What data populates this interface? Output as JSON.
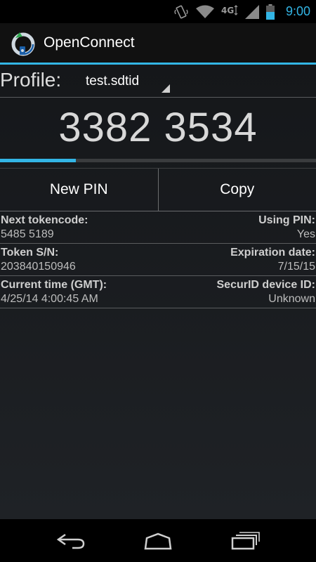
{
  "status_bar": {
    "time": "9:00",
    "network": "4G",
    "icons": [
      "vibrate-icon",
      "wifi-icon",
      "network-4g-icon",
      "signal-icon",
      "battery-icon"
    ]
  },
  "action_bar": {
    "title": "OpenConnect",
    "icon": "openconnect-logo-icon"
  },
  "profile": {
    "label": "Profile:",
    "selected": "test.sdtid"
  },
  "token": {
    "code": "3382 3534",
    "progress_percent": 24
  },
  "buttons": {
    "new_pin": "New PIN",
    "copy": "Copy"
  },
  "info": {
    "next_tokencode_label": "Next tokencode:",
    "next_tokencode_value": "5485 5189",
    "using_pin_label": "Using PIN:",
    "using_pin_value": "Yes",
    "token_sn_label": "Token S/N:",
    "token_sn_value": "203840150946",
    "expiration_label": "Expiration date:",
    "expiration_value": "7/15/15",
    "current_time_label": "Current time (GMT):",
    "current_time_value": "4/25/14 4:00:45 AM",
    "device_id_label": "SecurID device ID:",
    "device_id_value": "Unknown"
  },
  "colors": {
    "accent": "#33b5e5",
    "background": "#1a1c1f"
  },
  "nav_bar": {
    "icons": [
      "back-icon",
      "home-icon",
      "recents-icon"
    ]
  }
}
